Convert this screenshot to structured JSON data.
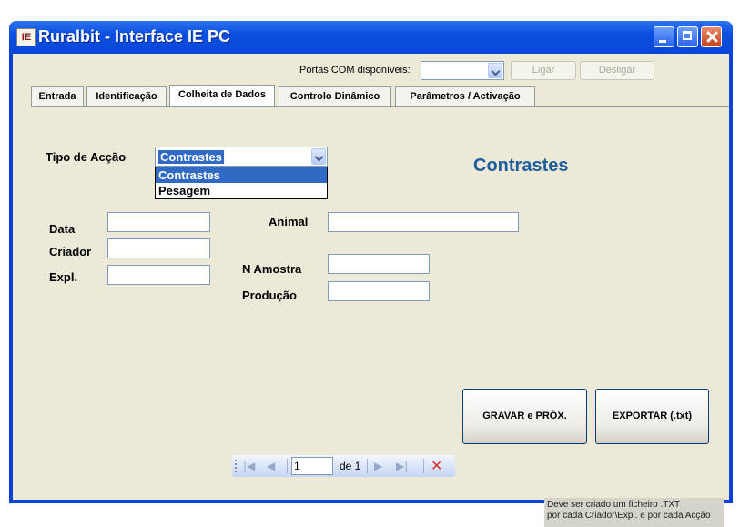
{
  "window": {
    "title": "Ruralbit - Interface IE PC",
    "app_icon_text": "IE",
    "controls": [
      "minimize-icon",
      "maximize-icon",
      "close-icon"
    ]
  },
  "toolbar": {
    "ports_label": "Portas COM disponíveis:",
    "port_value": "",
    "connect_label": "Ligar",
    "disconnect_label": "Desligar"
  },
  "tabs": [
    {
      "label": "Entrada"
    },
    {
      "label": "Identificação"
    },
    {
      "label": "Colheita de Dados",
      "active": true
    },
    {
      "label": "Controlo Dinâmico"
    },
    {
      "label": "Parâmetros / Activação"
    }
  ],
  "form": {
    "action_type_label": "Tipo de Acção",
    "action_type_value": "Contrastes",
    "action_options": [
      "Contrastes",
      "Pesagem"
    ],
    "heading": "Contrastes",
    "date_label": "Data",
    "breeder_label": "Criador",
    "expl_label": "Expl.",
    "animal_label": "Animal",
    "sample_label": "N Amostra",
    "production_label": "Produção",
    "date_value": "",
    "breeder_value": "",
    "expl_value": "",
    "animal_value": "",
    "sample_value": "",
    "production_value": ""
  },
  "buttons": {
    "save_next": "GRAVAR e PRÓX.",
    "export": "EXPORTAR (.txt)"
  },
  "navigator": {
    "position": "1",
    "count": "de 1"
  },
  "note": {
    "line1": "Deve ser criado um ficheiro .TXT",
    "line2": "por cada Criador\\Expl. e por cada Acção"
  },
  "colors": {
    "titlebar": "#0a4fe0",
    "client_bg": "#ece9d8",
    "heading": "#1f5e9c",
    "selection": "#316ac5"
  }
}
